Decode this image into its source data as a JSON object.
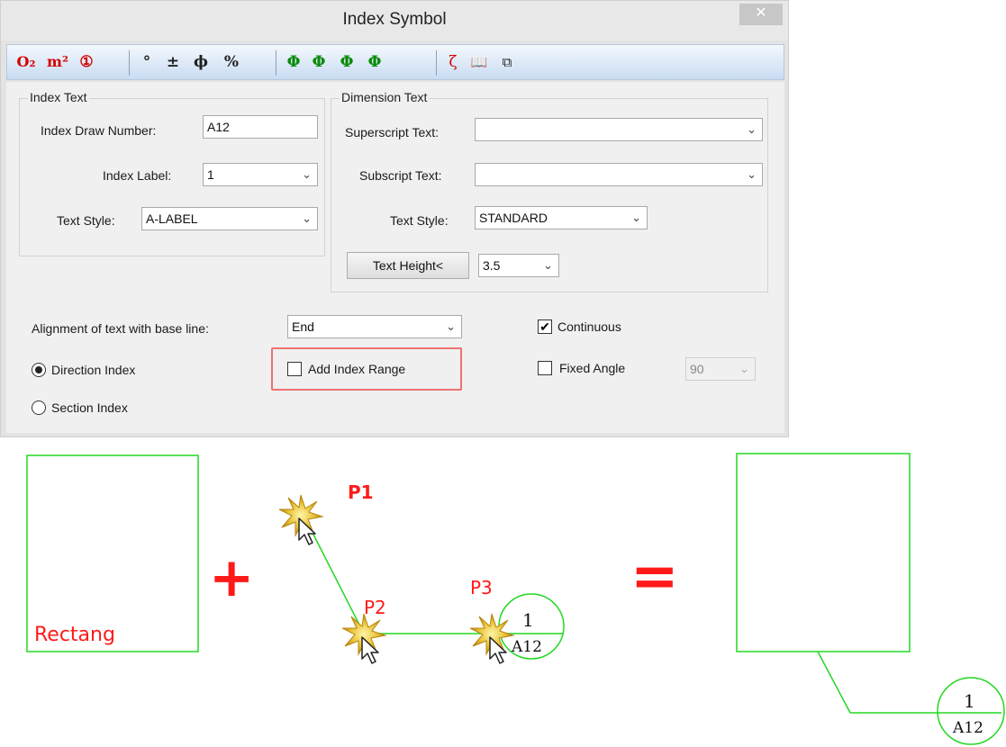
{
  "dialog": {
    "title": "Index Symbol",
    "close_glyph": "✕",
    "toolbar": {
      "items": [
        {
          "name": "o2-subscript-icon",
          "text": "O₂"
        },
        {
          "name": "m2-superscript-icon",
          "text": "m²"
        },
        {
          "name": "circled-number-icon",
          "text": "①"
        },
        {
          "name": "degree-icon",
          "text": "°"
        },
        {
          "name": "plus-minus-icon",
          "text": "±"
        },
        {
          "name": "diameter-icon",
          "text": "ϕ"
        },
        {
          "name": "percent-icon",
          "text": "%"
        },
        {
          "name": "rebar-grade-1-icon",
          "text": "Φ"
        },
        {
          "name": "rebar-grade-2-icon",
          "text": "Φ"
        },
        {
          "name": "rebar-grade-3-icon",
          "text": "Φ"
        },
        {
          "name": "rebar-grade-4-icon",
          "text": "Φ"
        },
        {
          "name": "special-char-icon",
          "text": "ζ"
        },
        {
          "name": "symbol-library-icon",
          "text": "📖"
        },
        {
          "name": "pick-text-icon",
          "text": "⧉"
        }
      ]
    },
    "index_text": {
      "group_title": "Index Text",
      "draw_number_label": "Index Draw Number:",
      "draw_number_value": "A12",
      "index_label_label": "Index Label:",
      "index_label_value": "1",
      "text_style_label": "Text Style:",
      "text_style_value": "A-LABEL"
    },
    "dimension_text": {
      "group_title": "Dimension Text",
      "superscript_label": "Superscript Text:",
      "superscript_value": "",
      "subscript_label": "Subscript Text:",
      "subscript_value": "",
      "text_style_label": "Text Style:",
      "text_style_value": "STANDARD",
      "text_height_button": "Text Height<",
      "text_height_value": "3.5"
    },
    "alignment_label": "Alignment of text with base line:",
    "alignment_value": "End",
    "continuous_label": "Continuous",
    "continuous_checked": true,
    "direction_index_label": "Direction Index",
    "section_index_label": "Section Index",
    "selected_index_type": "Direction Index",
    "add_index_range_label": "Add Index Range",
    "add_index_range_checked": false,
    "fixed_angle_label": "Fixed Angle",
    "fixed_angle_checked": false,
    "fixed_angle_value": "90",
    "chevron_glyph": "⌄",
    "checkmark_glyph": "✔"
  },
  "illustration": {
    "rect_label": "Rectang",
    "plus_sign": "+",
    "equals_sign": "=",
    "p1": "P1",
    "p2": "P2",
    "p3": "P3",
    "symbol_top": "1",
    "symbol_bottom": "A12",
    "result_top": "1",
    "result_bottom": "A12",
    "colors": {
      "line": "#22d822",
      "label": "#ff1a1a"
    }
  }
}
